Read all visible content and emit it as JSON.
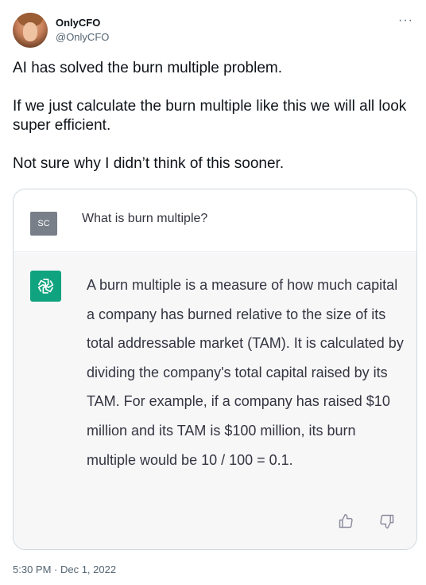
{
  "tweet": {
    "display_name": "OnlyCFO",
    "handle": "@OnlyCFO",
    "more_icon": "more-horizontal-icon",
    "text": {
      "p1": "AI has solved the burn multiple problem.",
      "p2": "If we just calculate the burn multiple like this we will all look super efficient.",
      "p3": "Not sure why I didn’t think of this sooner."
    },
    "timestamp": "5:30 PM · Dec 1, 2022"
  },
  "screenshot": {
    "user_avatar_text": "SC",
    "question": "What is burn multiple?",
    "assistant_icon": "openai-logo-icon",
    "answer": "A burn multiple is a measure of how much capital a company has burned relative to the size of its total addressable market (TAM). It is calculated by dividing the company's total capital raised by its TAM. For example, if a company has raised $10 million and its TAM is $100 million, its burn multiple would be 10 / 100 = 0.1.",
    "feedback_icons": [
      "thumbs-up-icon",
      "thumbs-down-icon"
    ]
  },
  "colors": {
    "openai_green": "#10a37f",
    "answer_bg": "#f7f7f8",
    "secondary_text": "#536471"
  }
}
